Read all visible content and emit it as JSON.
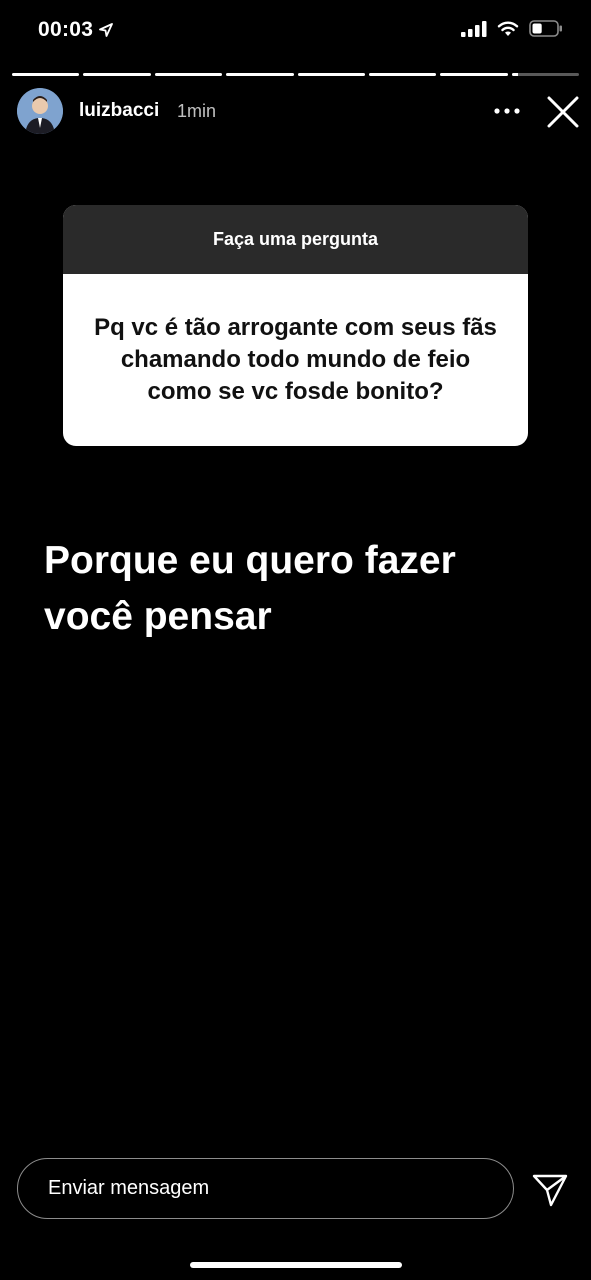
{
  "status_bar": {
    "time": "00:03",
    "location_icon": "location-arrow-icon",
    "signal_icon": "cellular-signal-icon",
    "wifi_icon": "wifi-icon",
    "battery_icon": "battery-icon",
    "battery_level": 0.4
  },
  "story": {
    "segments_total": 8,
    "segments_completed": 7,
    "current_segment_progress": 0.1
  },
  "header": {
    "username": "luizbacci",
    "time_ago": "1min",
    "more_icon": "more-horizontal-icon",
    "close_icon": "close-icon"
  },
  "question_card": {
    "title": "Faça uma pergunta",
    "question": "Pq vc é tão arrogante com seus fãs chamando todo mundo de feio como se vc fosde bonito?"
  },
  "answer": {
    "line1": "Porque eu quero fazer",
    "line2": "você pensar"
  },
  "footer": {
    "message_placeholder": "Enviar mensagem",
    "send_icon": "send-paper-plane-icon"
  },
  "colors": {
    "background": "#000000",
    "card_header": "#2a2a2a",
    "card_body": "#ffffff"
  }
}
